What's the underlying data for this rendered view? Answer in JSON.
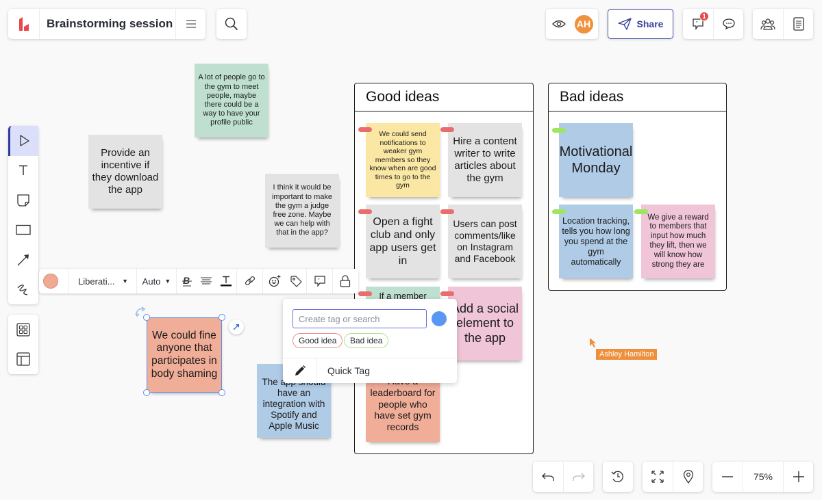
{
  "header": {
    "logo": "lucid-logo-icon",
    "document_title": "Brainstorming session",
    "menu_icon": "hamburger-menu-icon",
    "search_icon": "search-icon",
    "view_icon": "eye-icon",
    "avatar_initials": "AH",
    "share_label": "Share",
    "comments_badge": "1",
    "brand_color": "#e8474c",
    "accent_color": "#3a4296"
  },
  "left_toolbar": {
    "tools": [
      {
        "name": "select",
        "icon": "pointer-icon",
        "active": true
      },
      {
        "name": "text",
        "icon": "text-icon"
      },
      {
        "name": "sticky-note",
        "icon": "sticky-note-icon"
      },
      {
        "name": "shape",
        "icon": "rectangle-icon"
      },
      {
        "name": "line",
        "icon": "arrow-line-icon"
      },
      {
        "name": "freehand",
        "icon": "freehand-icon"
      }
    ],
    "views": [
      {
        "name": "templates",
        "icon": "grid-icon"
      },
      {
        "name": "layout",
        "icon": "layout-icon"
      }
    ]
  },
  "format_bar": {
    "fill_color": "#f0aa94",
    "font": "Liberati...",
    "font_size": "Auto"
  },
  "frames": [
    {
      "title": "Good ideas"
    },
    {
      "title": "Bad ideas"
    }
  ],
  "notes": {
    "loose": [
      "A lot of people go to the gym to meet people, maybe there could be a way to have your profile public",
      "Provide an incentive if they download the app",
      "I think it would be important to make the gym a judge free zone. Maybe we can help with that in the app?",
      "We could fine anyone that participates in body shaming",
      "The app should have an integration with Spotify and Apple Music"
    ],
    "good": [
      "We could send notifications to weaker gym members so they know when are good times to go to the gym",
      "Hire a content writer to write articles about the gym",
      "Open a fight club and only app users get in",
      "Users can post comments/like on Instagram and Facebook",
      "If a member",
      "Add a social element to the app",
      "Have a leaderboard for people who have set gym records"
    ],
    "bad": [
      "Motivational Monday",
      "Location tracking, tells you how long you spend at the gym automatically",
      "We give a reward to members that input how much they lift, then we will know how strong they are"
    ]
  },
  "tag_popup": {
    "input_value": "",
    "input_placeholder": "Create tag or search",
    "color": "#5a97f2",
    "tags": [
      {
        "label": "Good idea",
        "color": "#ea6c6c"
      },
      {
        "label": "Bad idea",
        "color": "#9fe660"
      }
    ],
    "quick_tag_label": "Quick Tag"
  },
  "collaborator_cursor": {
    "name": "Ashley Hamilton",
    "color": "#ee8f3c"
  },
  "bottom_bar": {
    "zoom_level": "75%"
  }
}
